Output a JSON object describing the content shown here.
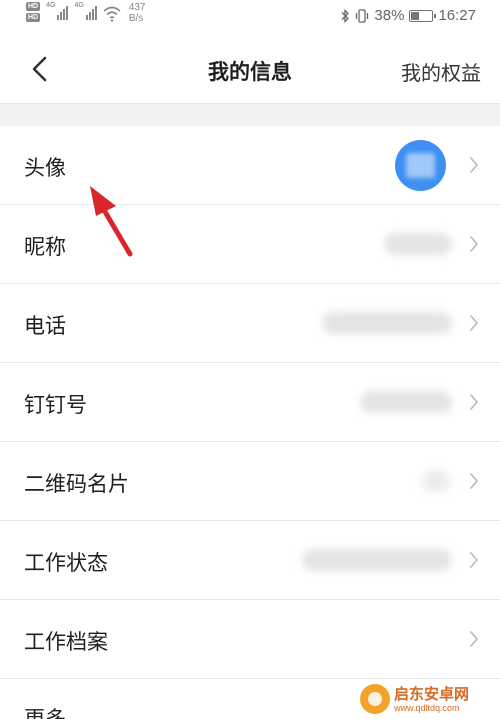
{
  "status_bar": {
    "hd_label_1": "HD",
    "hd_label_2": "HD",
    "signal_tag_1": "4G",
    "signal_tag_2": "4G",
    "speed_value": "437",
    "speed_unit": "B/s",
    "battery_percent": "38%",
    "battery_level": 0.38,
    "time": "16:27",
    "icons": [
      "signal-icon",
      "wifi-icon",
      "bluetooth-icon",
      "vibrate-icon",
      "battery-icon"
    ]
  },
  "header": {
    "back_icon": "chevron-left-icon",
    "title": "我的信息",
    "right_action": "我的权益"
  },
  "rows": [
    {
      "label": "头像"
    },
    {
      "label": "昵称"
    },
    {
      "label": "电话"
    },
    {
      "label": "钉钉号"
    },
    {
      "label": "二维码名片"
    },
    {
      "label": "工作状态"
    },
    {
      "label": "工作档案"
    },
    {
      "label": "更多"
    }
  ],
  "annotation": {
    "arrow_color": "#d9262c"
  },
  "colors": {
    "avatar": "#3d8ff2",
    "divider": "#e9e9ea",
    "gap": "#f2f2f3"
  },
  "watermark": {
    "name": "启东安卓网",
    "url": "www.qdltdq.com"
  }
}
